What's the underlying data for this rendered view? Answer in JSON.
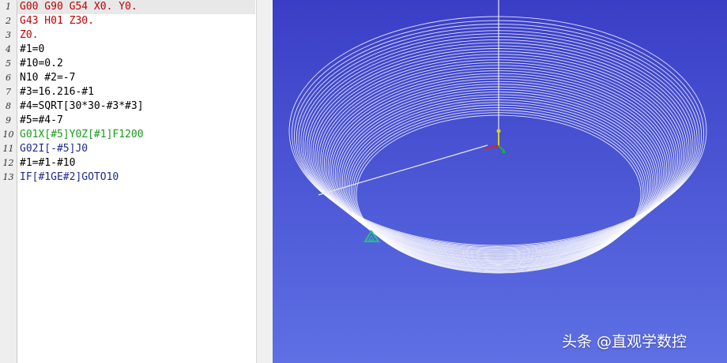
{
  "editor": {
    "lines": [
      {
        "num": "1",
        "text": "G00 G90 G54 X0. Y0.",
        "color": "#c00000"
      },
      {
        "num": "2",
        "text": "G43 H01 Z30.",
        "color": "#c00000"
      },
      {
        "num": "3",
        "text": "Z0.",
        "color": "#c00000"
      },
      {
        "num": "4",
        "text": "#1=0",
        "color": "#000000"
      },
      {
        "num": "5",
        "text": "#10=0.2",
        "color": "#000000"
      },
      {
        "num": "6",
        "text": "N10 #2=-7",
        "color": "#000000"
      },
      {
        "num": "7",
        "text": "#3=16.216-#1",
        "color": "#000000"
      },
      {
        "num": "8",
        "text": "#4=SQRT[30*30-#3*#3]",
        "color": "#000000"
      },
      {
        "num": "9",
        "text": "#5=#4-7",
        "color": "#000000"
      },
      {
        "num": "10",
        "text": "G01X[#5]Y0Z[#1]F1200",
        "color": "#1a9a1a"
      },
      {
        "num": "11",
        "text": "G02I[-#5]J0",
        "color": "#1c2a8c"
      },
      {
        "num": "12",
        "text": "#1=#1-#10",
        "color": "#000000"
      },
      {
        "num": "13",
        "text": "IF[#1GE#2]GOTO10",
        "color": "#1c2a8c"
      }
    ]
  },
  "viewport": {
    "background_top": "#3a3ec6",
    "background_bottom": "#5e70e4",
    "toolpath_color": "#ffffff",
    "marker_color": "#22c08a",
    "axes": {
      "x_color": "#e02020",
      "y_color": "#20b040",
      "z_color": "#e0d020"
    }
  },
  "watermark": "头条 @直观学数控"
}
